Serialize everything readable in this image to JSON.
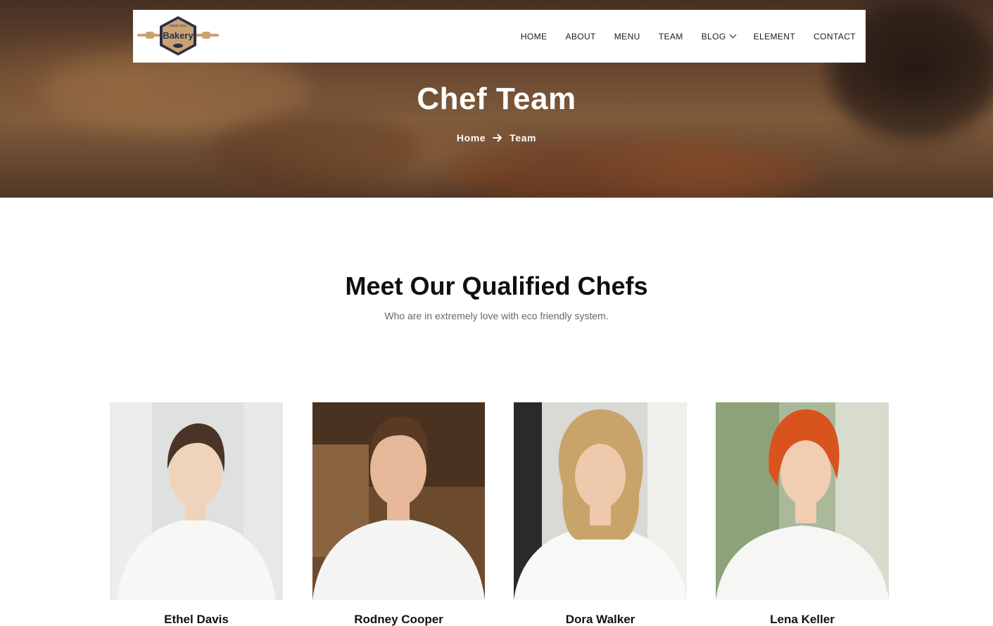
{
  "brand": {
    "logo_top_text": "SINCE 2014",
    "logo_text": "Bakery",
    "accent_color": "#c9a274",
    "logo_dark": "#2a2f45"
  },
  "nav": {
    "items": [
      {
        "label": "HOME"
      },
      {
        "label": "ABOUT"
      },
      {
        "label": "MENU"
      },
      {
        "label": "TEAM"
      },
      {
        "label": "BLOG"
      },
      {
        "label": "ELEMENT"
      },
      {
        "label": "CONTACT"
      }
    ]
  },
  "hero": {
    "title": "Chef Team",
    "breadcrumb": [
      {
        "label": "Home"
      },
      {
        "label": "Team"
      }
    ]
  },
  "section": {
    "title": "Meet Our Qualified Chefs",
    "subtitle": "Who are in extremely love with eco friendly system."
  },
  "chefs": [
    {
      "name": "Ethel Davis"
    },
    {
      "name": "Rodney Cooper"
    },
    {
      "name": "Dora Walker"
    },
    {
      "name": "Lena Keller"
    }
  ]
}
